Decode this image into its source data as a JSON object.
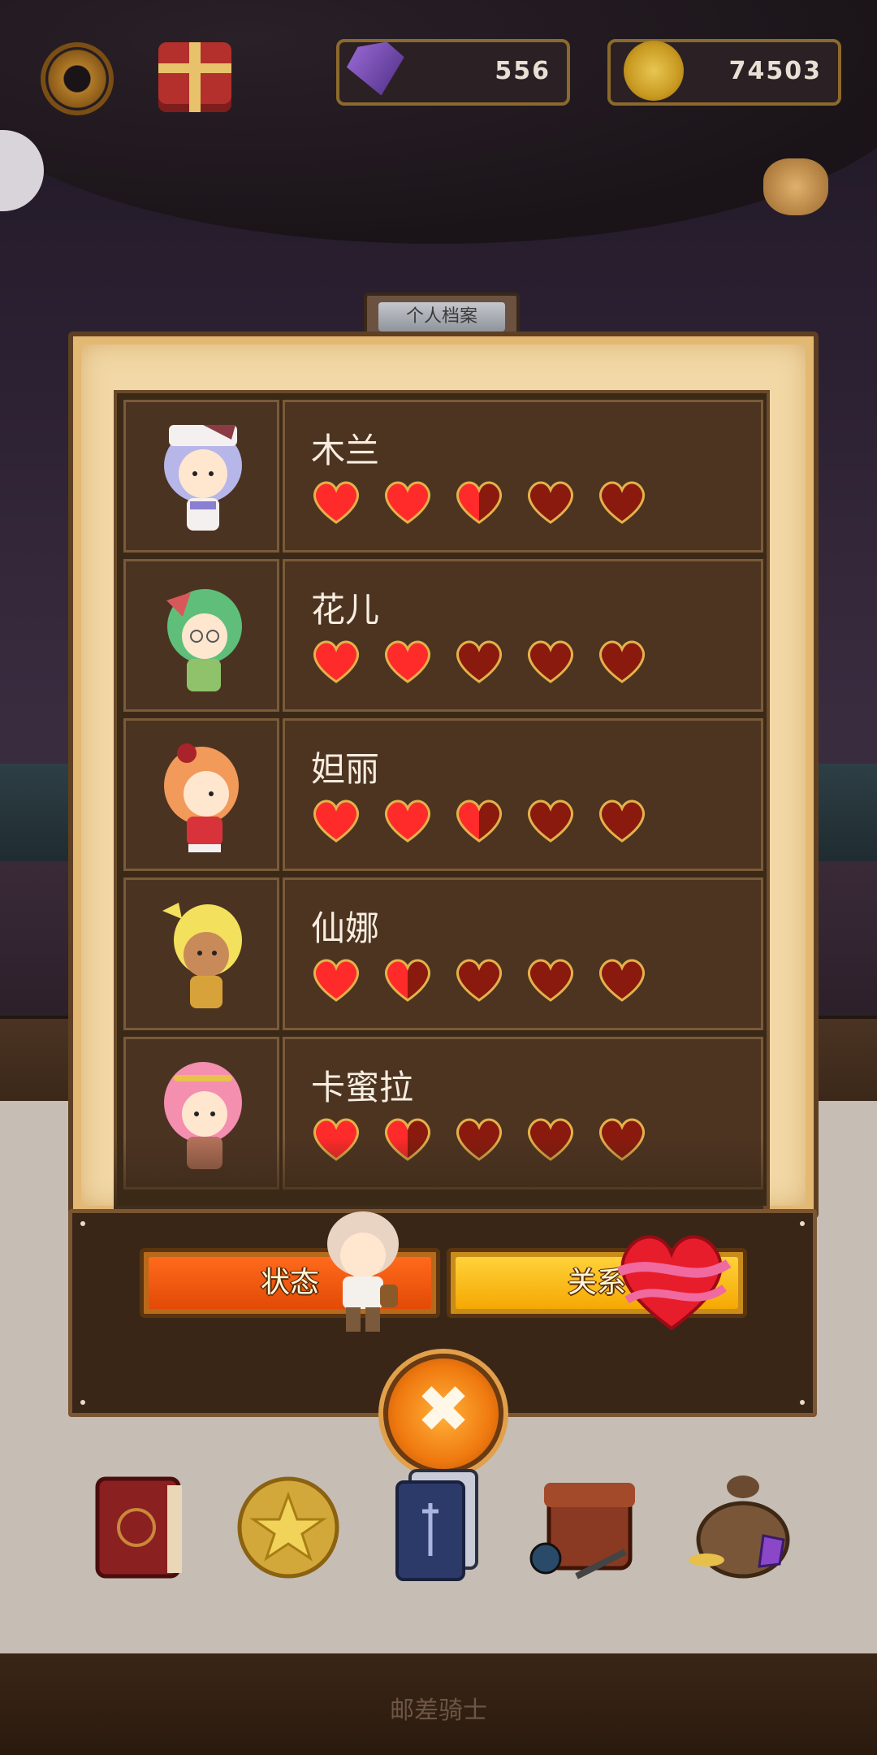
{
  "hud": {
    "gems": "556",
    "coins": "74503"
  },
  "panel": {
    "title": "个人档案"
  },
  "characters": [
    {
      "name": "木兰",
      "hearts": 2.5,
      "max_hearts": 5
    },
    {
      "name": "花儿",
      "hearts": 2,
      "max_hearts": 5
    },
    {
      "name": "妲丽",
      "hearts": 2.5,
      "max_hearts": 5
    },
    {
      "name": "仙娜",
      "hearts": 1.5,
      "max_hearts": 5
    },
    {
      "name": "卡蜜拉",
      "hearts": 1.5,
      "max_hearts": 5
    }
  ],
  "tabs": {
    "status_label": "状态",
    "relation_label": "关系"
  },
  "footer": {
    "brand": "邮差骑士"
  },
  "colors": {
    "heart_full": "#ff2a2a",
    "heart_empty": "#8a1a0e",
    "heart_outline": "#e2b24a"
  },
  "icons": {
    "close": "close-icon",
    "settings": "gear-icon",
    "gift": "gift-icon"
  }
}
